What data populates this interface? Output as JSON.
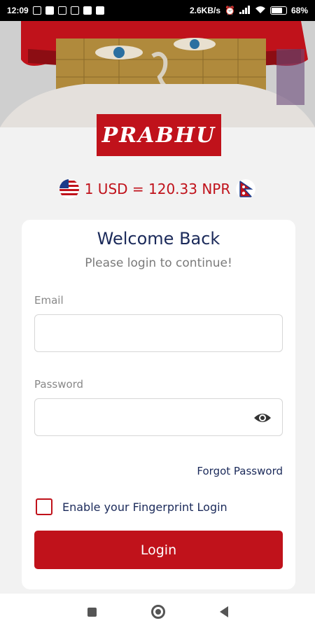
{
  "status_bar": {
    "time": "12:09",
    "network_speed": "2.6KB/s",
    "battery": "68%"
  },
  "brand": {
    "logo_text": "PRABHU",
    "accent_color": "#c0121b"
  },
  "exchange_rate": {
    "text": "1 USD = 120.33 NPR",
    "from_flag_icon": "us-flag-icon",
    "to_flag_icon": "nepal-flag-icon"
  },
  "login_card": {
    "title": "Welcome Back",
    "subtitle": "Please login to continue!",
    "email_label": "Email",
    "email_value": "",
    "password_label": "Password",
    "password_value": "",
    "forgot_password": "Forgot Password",
    "fingerprint_label": "Enable your Fingerprint Login",
    "fingerprint_checked": false,
    "login_button": "Login"
  },
  "nav_icons": [
    "recents-icon",
    "home-icon",
    "back-icon"
  ]
}
